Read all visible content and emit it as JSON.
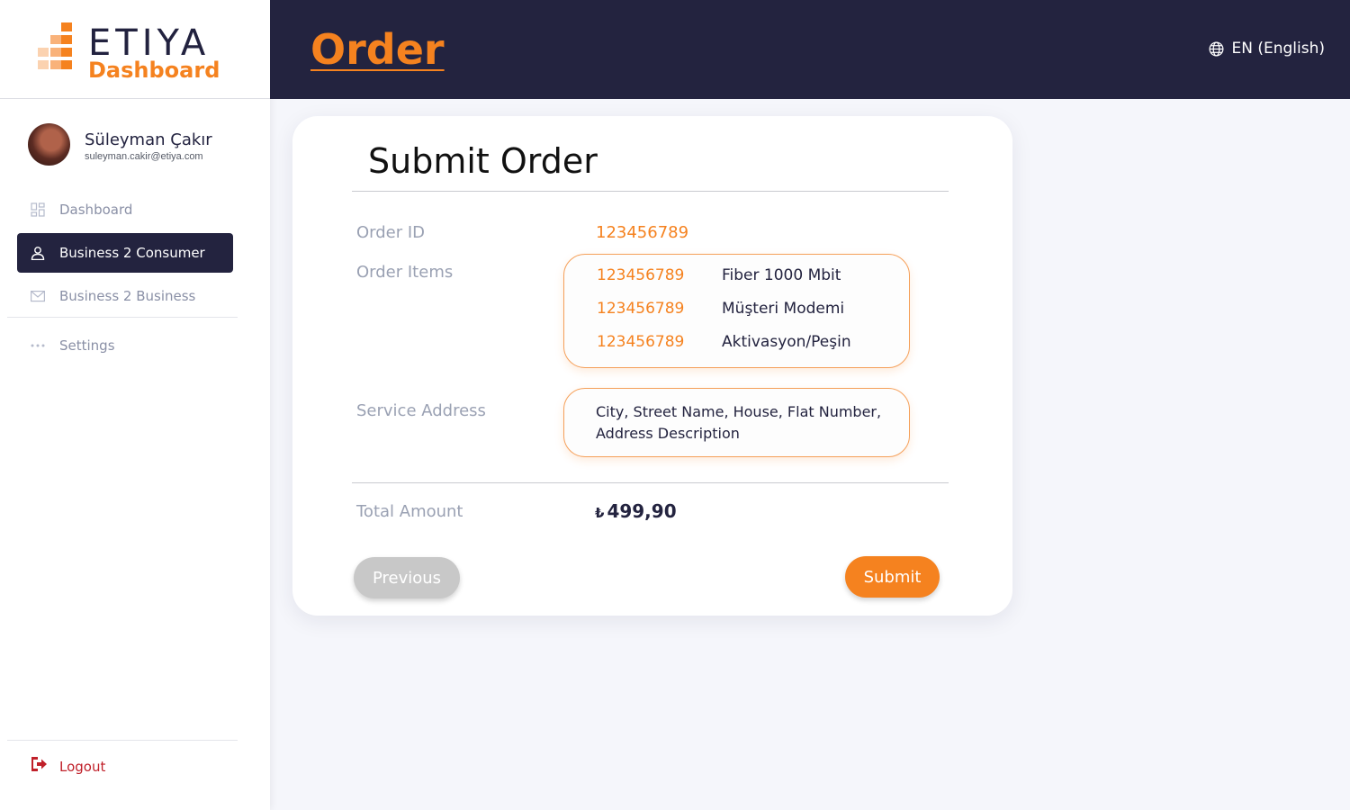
{
  "brand": {
    "name": "ETIYA",
    "subtitle": "Dashboard",
    "accent_color": "#f5821f",
    "dark_color": "#23233f"
  },
  "user": {
    "name": "Süleyman Çakır",
    "email": "suleyman.cakir@etiya.com"
  },
  "sidebar": {
    "items": [
      {
        "label": "Dashboard",
        "icon": "grid-icon",
        "active": false
      },
      {
        "label": "Business 2 Consumer",
        "icon": "user-icon",
        "active": true
      },
      {
        "label": "Business 2 Business",
        "icon": "mail-icon",
        "active": false
      },
      {
        "label": "Settings",
        "icon": "more-dots-icon",
        "active": false
      }
    ],
    "logout_label": "Logout"
  },
  "header": {
    "title": "Order",
    "language": "EN (English)"
  },
  "card": {
    "title": "Submit Order",
    "order_id_label": "Order ID",
    "order_id_value": "123456789",
    "order_items_label": "Order Items",
    "order_items": [
      {
        "code": "123456789",
        "name": "Fiber 1000 Mbit"
      },
      {
        "code": "123456789",
        "name": "Müşteri Modemi"
      },
      {
        "code": "123456789",
        "name": "Aktivasyon/Peşin"
      }
    ],
    "service_address_label": "Service Address",
    "service_address_value": "City, Street Name, House, Flat Number, Address Description",
    "total_label": "Total Amount",
    "total_currency": "₺",
    "total_value": "499,90",
    "previous_label": "Previous",
    "submit_label": "Submit"
  }
}
